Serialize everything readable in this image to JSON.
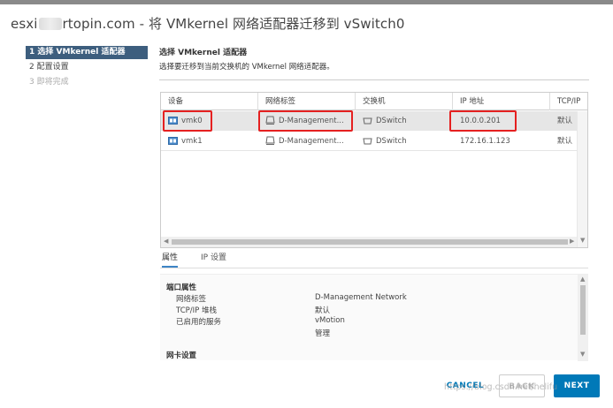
{
  "dialog": {
    "title_prefix": "esxi",
    "title_suffix": "rtopin.com - 将 VMkernel 网络适配器迁移到 vSwitch0"
  },
  "steps": [
    {
      "label": "1 选择 VMkernel 适配器"
    },
    {
      "label": "2 配置设置"
    },
    {
      "label": "3 即将完成"
    }
  ],
  "main": {
    "heading": "选择 VMkernel 适配器",
    "description": "选择要迁移到当前交换机的 VMkernel 网络适配器。"
  },
  "grid": {
    "columns": [
      "设备",
      "网络标签",
      "交换机",
      "IP 地址",
      "TCP/IP"
    ],
    "rows": [
      {
        "device": "vmk0",
        "network": "D-Management...",
        "switch": "DSwitch",
        "ip": "10.0.0.201",
        "tcpip": "默认"
      },
      {
        "device": "vmk1",
        "network": "D-Management...",
        "switch": "DSwitch",
        "ip": "172.16.1.123",
        "tcpip": "默认"
      }
    ]
  },
  "tabs": [
    "属性",
    "IP 设置"
  ],
  "properties": {
    "section1": "端口属性",
    "items": [
      {
        "label": "网络标签",
        "value": "D-Management Network"
      },
      {
        "label": "TCP/IP 堆栈",
        "value": "默认"
      },
      {
        "label": "已启用的服务",
        "value": "vMotion"
      }
    ],
    "extra_service": "管理",
    "section2": "网卡设置"
  },
  "buttons": {
    "cancel": "CANCEL",
    "back": "BACK",
    "next": "NEXT"
  },
  "watermark": "https://blog.csdn.net/helifu",
  "icons": {
    "vmk": "nic-icon",
    "network": "network-portgroup-icon",
    "switch": "distributed-switch-icon"
  },
  "colors": {
    "active_step": "#3d5e7e",
    "primary": "#0079b8",
    "highlight_box": "#e52020",
    "tab_underline": "#3d85c6",
    "selected_row": "#e6e6e6"
  },
  "state": {
    "selected_row": 0,
    "active_tab": 0,
    "active_step": 0
  }
}
